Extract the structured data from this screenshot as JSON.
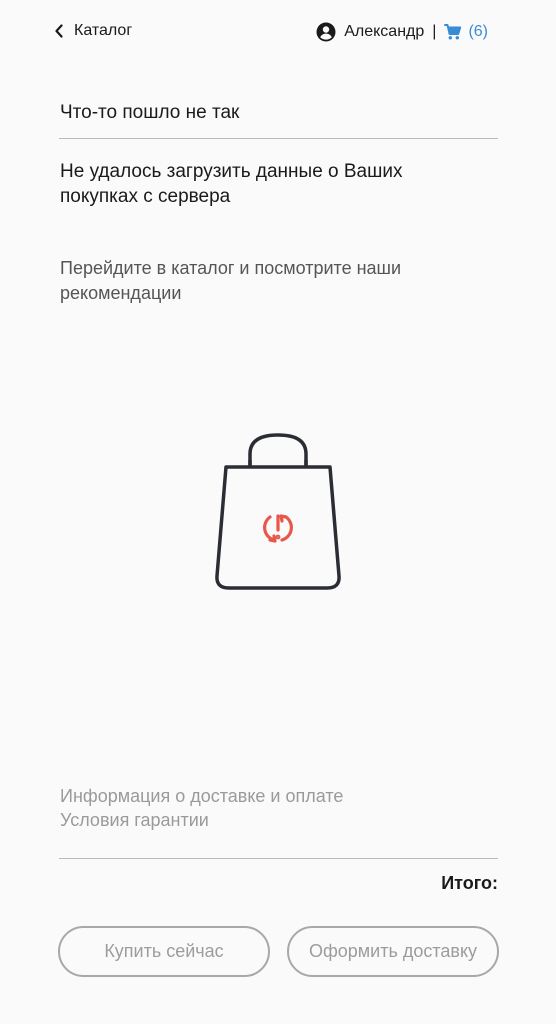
{
  "header": {
    "back_label": "Каталог",
    "user_name": "Александр",
    "separator": "|",
    "cart_count": "(6)"
  },
  "main": {
    "title": "Что-то пошло не так",
    "error_message": "Не удалось загрузить данные о Ваших покупках с сервера",
    "hint": "Перейдите в каталог и посмотрите наши рекомендации"
  },
  "footer": {
    "links": [
      "Информация о доставке и оплате",
      "Условия гарантии"
    ],
    "total_label": "Итого:",
    "buy_now_label": "Купить сейчас",
    "delivery_label": "Оформить доставку"
  },
  "icons": {
    "back": "chevron-left-icon",
    "user": "user-circle-icon",
    "cart": "shopping-cart-icon",
    "illustration": "shopping-bag-error-icon"
  },
  "colors": {
    "accent": "#3a8bd6",
    "error": "#e8584a",
    "button_border": "#a8a8a8"
  }
}
